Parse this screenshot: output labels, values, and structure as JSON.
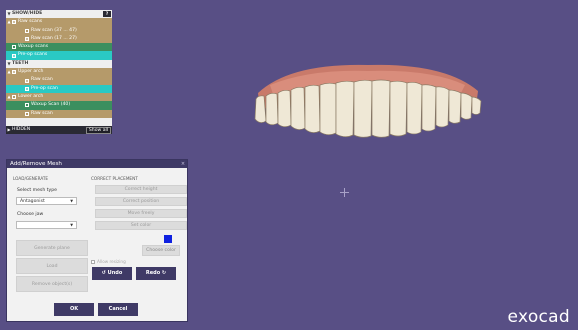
{
  "brand": "exocad",
  "tree": {
    "show_hide_label": "SHOW/HIDE",
    "show_hide_btn": "?",
    "raw_scans_label": "Raw scans",
    "raw_scan_1": "Raw scan (37 ... 47)",
    "raw_scan_2": "Raw scan (17 ... 27)",
    "waxup_scans": "Waxup scans",
    "preop_scans": "Pre-op scans",
    "teeth_label": "TEETH",
    "upper_arch": "Upper arch",
    "upper_raw_scan": "Raw scan",
    "upper_preop_scan": "Pre-op scan",
    "lower_arch": "Lower arch",
    "lower_waxup_scan": "Waxup Scan (40)",
    "lower_raw_scan": "Raw scan",
    "hidden_label": "HIDDEN",
    "show_all": "Show all"
  },
  "dialog": {
    "title": "Add/Remove Mesh",
    "close": "×",
    "load_generate_title": "LOAD/GENERATE",
    "correct_placement_title": "CORRECT PLACEMENT",
    "select_mesh_type_label": "Select mesh type",
    "mesh_type_value": "Antagonist",
    "choose_jaw_label": "Choose jaw",
    "jaw_value": "",
    "generate_plane": "Generate plane",
    "load": "Load",
    "remove_objects": "Remove object(s)",
    "correct_height": "Correct height",
    "correct_position": "Correct position",
    "move_freely": "Move freely",
    "set_color": "Set color",
    "choose_color": "Choose color",
    "allow_resizing": "Allow resizing",
    "undo": "Undo",
    "redo": "Redo",
    "ok": "OK",
    "cancel": "Cancel"
  },
  "colors": {
    "background": "#584f85",
    "dialog_title": "#3f3a66",
    "row_tan": "#b59a6a",
    "row_green": "#3b8f5f",
    "row_cyan": "#2ac9c4",
    "mesh_color": "#0f21e0"
  }
}
